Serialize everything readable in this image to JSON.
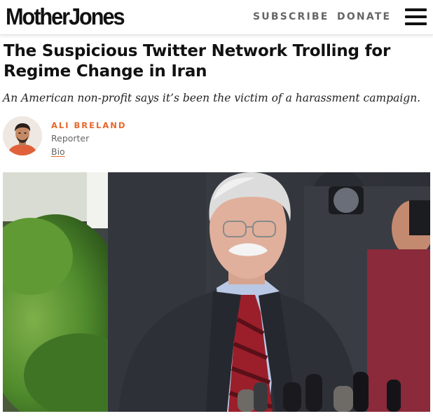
{
  "header": {
    "logo": "MotherJones",
    "nav": {
      "subscribe": "SUBSCRIBE",
      "donate": "DONATE"
    },
    "menu_icon": "hamburger-menu-icon"
  },
  "article": {
    "headline": "The Suspicious Twitter Network Trolling for Regime Change in Iran",
    "dek": "An American non-profit says it’s been the victim of a harassment campaign.",
    "author": {
      "name": "ALI BRELAND",
      "role": "Reporter",
      "bio_link": "Bio"
    },
    "hero_image": "photo-man-speaking-at-microphones"
  },
  "colors": {
    "accent": "#e8662a",
    "text": "#111111",
    "muted": "#666666"
  }
}
